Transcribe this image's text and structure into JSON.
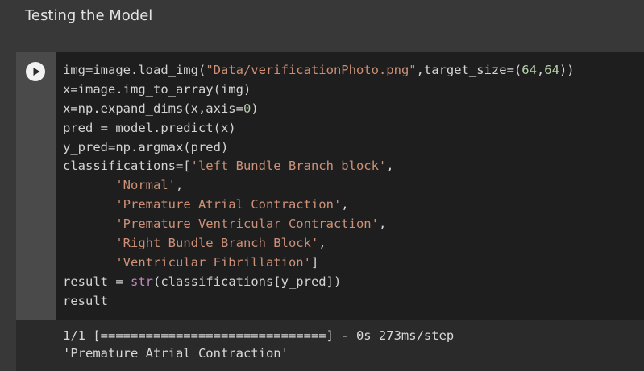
{
  "text_cell": {
    "heading": "Testing the Model"
  },
  "code_cell": {
    "run_button_icon": "play-icon",
    "lines": [
      [
        {
          "t": "img=image.load_img(",
          "k": "plain"
        },
        {
          "t": "\"Data/verificationPhoto.png\"",
          "k": "str"
        },
        {
          "t": ",target_size=(",
          "k": "plain"
        },
        {
          "t": "64",
          "k": "num"
        },
        {
          "t": ",",
          "k": "plain"
        },
        {
          "t": "64",
          "k": "num"
        },
        {
          "t": "))",
          "k": "plain"
        }
      ],
      [
        {
          "t": "x=image.img_to_array(img)",
          "k": "plain"
        }
      ],
      [
        {
          "t": "x=np.expand_dims(x,axis=",
          "k": "plain"
        },
        {
          "t": "0",
          "k": "num"
        },
        {
          "t": ")",
          "k": "plain"
        }
      ],
      [
        {
          "t": "pred = model.predict(x)",
          "k": "plain"
        }
      ],
      [
        {
          "t": "y_pred=np.argmax(pred)",
          "k": "plain"
        }
      ],
      [
        {
          "t": "classifications=[",
          "k": "plain"
        },
        {
          "t": "'left Bundle Branch block'",
          "k": "str"
        },
        {
          "t": ",",
          "k": "plain"
        }
      ],
      [
        {
          "t": "       ",
          "k": "plain"
        },
        {
          "t": "'Normal'",
          "k": "str"
        },
        {
          "t": ",",
          "k": "plain"
        }
      ],
      [
        {
          "t": "       ",
          "k": "plain"
        },
        {
          "t": "'Premature Atrial Contraction'",
          "k": "str"
        },
        {
          "t": ",",
          "k": "plain"
        }
      ],
      [
        {
          "t": "       ",
          "k": "plain"
        },
        {
          "t": "'Premature Ventricular Contraction'",
          "k": "str"
        },
        {
          "t": ",",
          "k": "plain"
        }
      ],
      [
        {
          "t": "       ",
          "k": "plain"
        },
        {
          "t": "'Right Bundle Branch Block'",
          "k": "str"
        },
        {
          "t": ",",
          "k": "plain"
        }
      ],
      [
        {
          "t": "       ",
          "k": "plain"
        },
        {
          "t": "'Ventricular Fibrillation'",
          "k": "str"
        },
        {
          "t": "]",
          "k": "plain"
        }
      ],
      [
        {
          "t": "result = ",
          "k": "plain"
        },
        {
          "t": "str",
          "k": "fn"
        },
        {
          "t": "(classifications[y_pred])",
          "k": "plain"
        }
      ],
      [
        {
          "t": "result",
          "k": "plain"
        }
      ]
    ]
  },
  "output": {
    "lines": [
      "1/1 [==============================] - 0s 273ms/step",
      "'Premature Atrial Contraction'"
    ]
  }
}
